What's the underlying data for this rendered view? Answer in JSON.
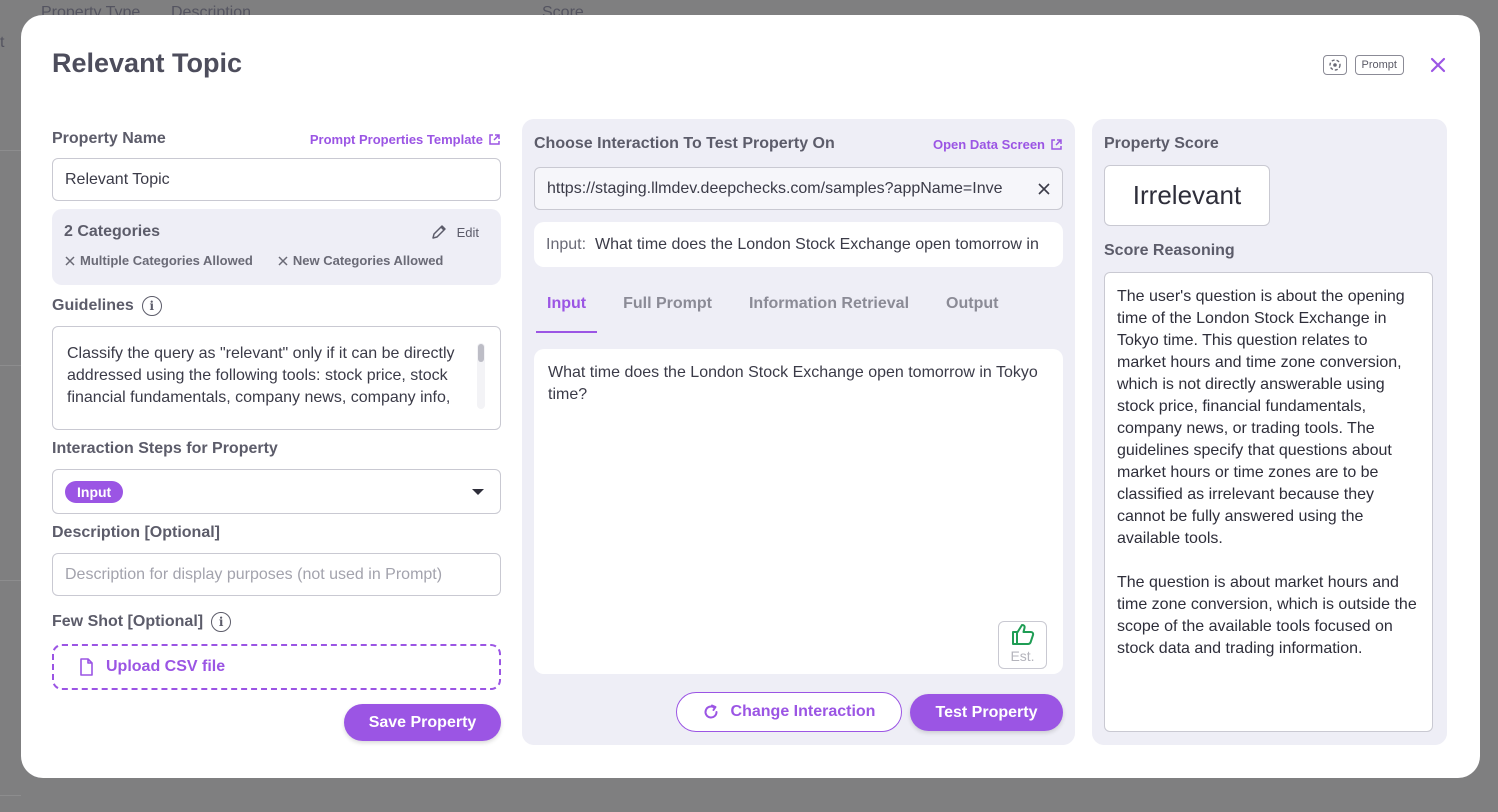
{
  "backdrop": {
    "col_property_type": "Property Type",
    "col_description": "Description",
    "col_score": "Score",
    "edge_char": "t"
  },
  "modal": {
    "title": "Relevant Topic",
    "prompt_chip": "Prompt"
  },
  "left": {
    "property_name_label": "Property Name",
    "template_link": "Prompt Properties Template",
    "property_name_value": "Relevant Topic",
    "categories_title": "2 Categories",
    "edit_label": "Edit",
    "flag_multiple": "Multiple Categories Allowed",
    "flag_new": "New Categories Allowed",
    "guidelines_label": "Guidelines",
    "guidelines_text": "Classify the query as \"relevant\" only if it can be directly addressed using the following tools: stock price, stock financial fundamentals, company news, company info,",
    "steps_label": "Interaction Steps for Property",
    "steps_selected": "Input",
    "description_label": "Description [Optional]",
    "description_placeholder": "Description for display purposes (not used in Prompt)",
    "few_shot_label": "Few Shot [Optional]",
    "upload_label": "Upload CSV file",
    "save_button": "Save Property"
  },
  "middle": {
    "choose_label": "Choose Interaction To Test Property On",
    "open_data_link": "Open Data Screen",
    "url": "https://staging.llmdev.deepchecks.com/samples?appName=Inve",
    "input_key": "Input:",
    "input_value": "What time does the London Stock Exchange open tomorrow in Tokyo time?",
    "tabs": [
      "Input",
      "Full Prompt",
      "Information Retrieval",
      "Output"
    ],
    "content": "What time does the London Stock Exchange open tomorrow in Tokyo time?",
    "est_label": "Est.",
    "change_button": "Change Interaction",
    "test_button": "Test Property"
  },
  "right": {
    "score_label": "Property Score",
    "score_value": "Irrelevant",
    "reasoning_label": "Score Reasoning",
    "reasoning_text": "The user's question is about the opening time of the London Stock Exchange in Tokyo time. This question relates to market hours and time zone conversion, which is not directly answerable using stock price, financial fundamentals, company news, or trading tools. The guidelines specify that questions about market hours or time zones are to be classified as irrelevant because they cannot be fully answered using the available tools.\n\nThe question is about market hours and time zone conversion, which is outside the scope of the available tools focused on stock data and trading information."
  },
  "colors": {
    "accent": "#9b55e4",
    "panel_bg": "#eeeef6",
    "thumb_green": "#1f9d55"
  },
  "icons": {
    "camera": "camera-focus-icon",
    "close": "close-icon",
    "external_link": "external-link-icon",
    "pencil": "pencil-icon",
    "x_flag": "x-icon",
    "info": "info-icon",
    "chevron": "chevron-down-icon",
    "file": "file-icon",
    "refresh": "refresh-icon",
    "thumbs_up": "thumbs-up-icon"
  }
}
